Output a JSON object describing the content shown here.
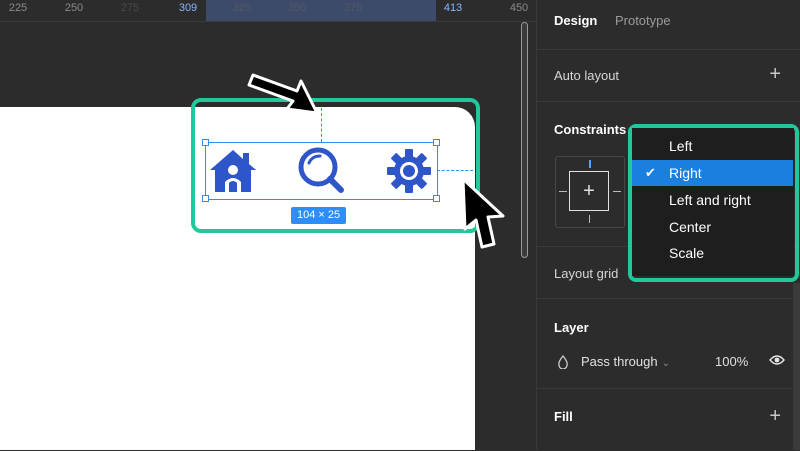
{
  "ruler": {
    "ticks": [
      "225",
      "250",
      "275",
      "309",
      "325",
      "350",
      "375",
      "413",
      "450"
    ]
  },
  "canvas": {
    "size_badge": "104 × 25"
  },
  "icons": [
    "home-icon",
    "search-icon",
    "gear-icon"
  ],
  "panel": {
    "tabs": [
      "Design",
      "Prototype"
    ],
    "active_tab": "Design",
    "auto_layout": "Auto layout",
    "constraints": "Constraints",
    "layout_grid": "Layout grid",
    "layer": {
      "title": "Layer",
      "blend_mode": "Pass through",
      "opacity": "100%"
    },
    "fill": "Fill"
  },
  "dropdown": {
    "items": [
      "Left",
      "Right",
      "Left and right",
      "Center",
      "Scale"
    ],
    "selected": "Right",
    "check": "✔"
  },
  "colors": {
    "accent_highlight": "#22c79b",
    "selection_blue": "#2c8ef8",
    "icon_blue": "#2f56c8",
    "menu_selected": "#1b7fe0"
  }
}
